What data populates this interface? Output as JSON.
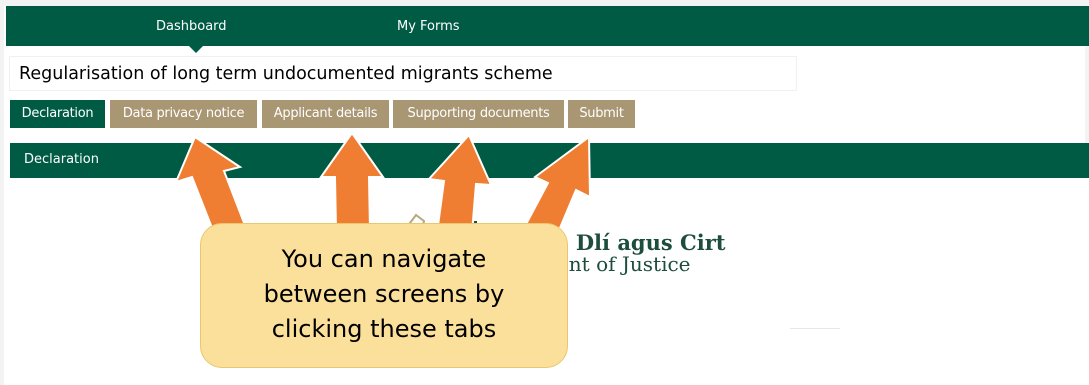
{
  "topnav": {
    "dashboard_label": "Dashboard",
    "myforms_label": "My Forms"
  },
  "form": {
    "title": "Regularisation of long term undocumented migrants scheme"
  },
  "tabs": [
    {
      "label": "Declaration",
      "active": true
    },
    {
      "label": "Data privacy notice",
      "active": false
    },
    {
      "label": "Applicant details",
      "active": false
    },
    {
      "label": "Supporting documents",
      "active": false
    },
    {
      "label": "Submit",
      "active": false
    }
  ],
  "section": {
    "title": "Declaration"
  },
  "department": {
    "line1": "nn Dlí agus Cirt",
    "line2": "ment of Justice"
  },
  "callout": {
    "line1": "You can navigate",
    "line2": "between screens by",
    "line3": "clicking these tabs"
  },
  "colors": {
    "brand_green": "#005b45",
    "tab_tan": "#a99672",
    "arrow_orange": "#ef7d32",
    "callout_fill": "#fbe09b"
  },
  "icons": {
    "nav_caret": "caret-down-icon",
    "logo": "harp-logo-icon"
  }
}
